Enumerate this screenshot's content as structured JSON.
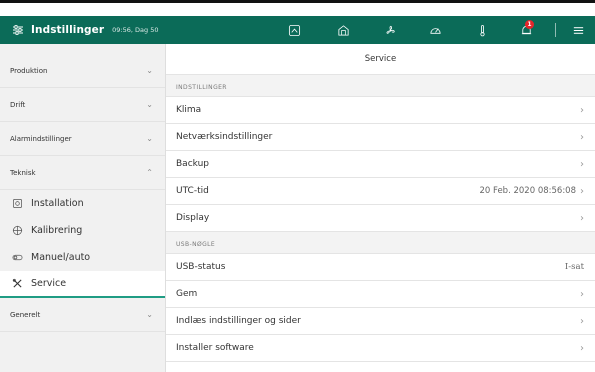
{
  "header": {
    "title": "Indstillinger",
    "time": "09:56, Dag 50",
    "notification_count": "1",
    "icons": [
      "home-icon",
      "barn-icon",
      "fan-icon",
      "gauge-icon",
      "thermometer-icon",
      "bell-icon",
      "menu-icon"
    ],
    "bg_color": "#0b6b58"
  },
  "sidebar": {
    "sections": [
      {
        "label": "Produktion"
      },
      {
        "label": "Drift"
      },
      {
        "label": "Alarmindstillinger"
      },
      {
        "label": "Teknisk"
      },
      {
        "label": "Generelt"
      }
    ],
    "items": [
      {
        "label": "Installation",
        "icon": "installation-icon"
      },
      {
        "label": "Kalibrering",
        "icon": "calibration-icon"
      },
      {
        "label": "Manuel/auto",
        "icon": "toggle-icon"
      },
      {
        "label": "Service",
        "icon": "tools-icon"
      }
    ],
    "active_color": "#1f9c84"
  },
  "main": {
    "title": "Service",
    "groups": [
      {
        "label": "INDSTILLINGER",
        "rows": [
          {
            "label": "Klima",
            "value": ""
          },
          {
            "label": "Netværksindstillinger",
            "value": ""
          },
          {
            "label": "Backup",
            "value": ""
          },
          {
            "label": "UTC-tid",
            "value": "20 Feb. 2020 08:56:08"
          },
          {
            "label": "Display",
            "value": ""
          }
        ]
      },
      {
        "label": "USB-NØGLE",
        "rows": [
          {
            "label": "USB-status",
            "value": "I-sat"
          },
          {
            "label": "Gem",
            "value": ""
          },
          {
            "label": "Indlæs indstillinger og sider",
            "value": ""
          },
          {
            "label": "Installer software",
            "value": ""
          }
        ]
      }
    ]
  }
}
